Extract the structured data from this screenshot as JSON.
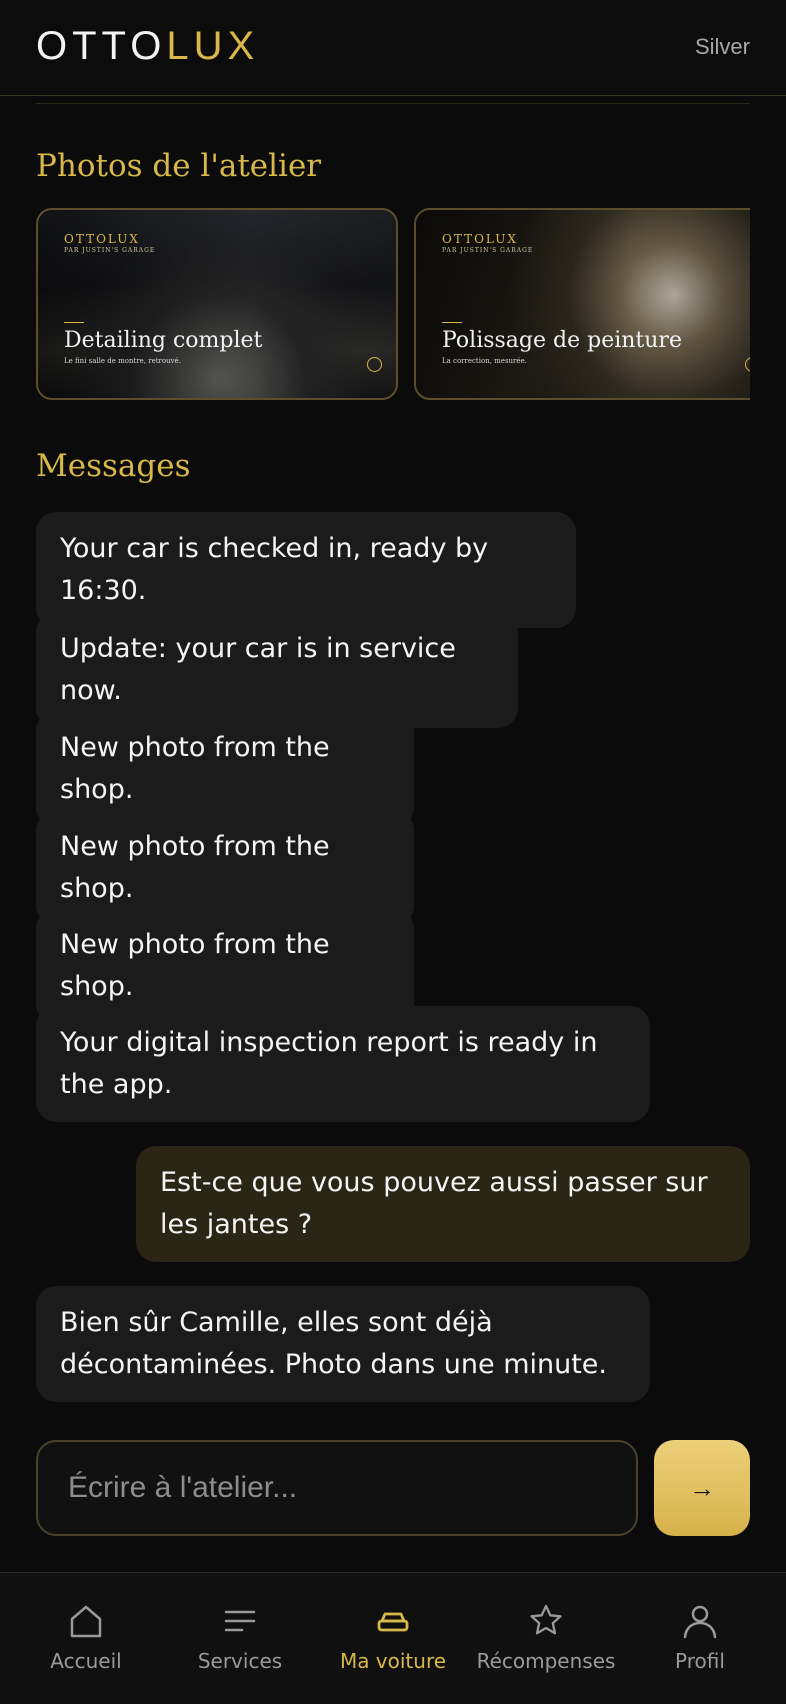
{
  "header": {
    "logo_part1": "OTTO",
    "logo_part2": "LUX",
    "tier": "Silver"
  },
  "photos_section": {
    "title": "Photos de l'atelier",
    "cards": [
      {
        "brand": "OTTOLUX",
        "sub_brand": "PAR JUSTIN'S GARAGE",
        "title": "Detailing complet",
        "caption": "Le fini salle de montre, retrouvé."
      },
      {
        "brand": "OTTOLUX",
        "sub_brand": "PAR JUSTIN'S GARAGE",
        "title": "Polissage de peinture",
        "caption": "La correction, mesurée."
      }
    ]
  },
  "messages_section": {
    "title": "Messages",
    "messages": [
      {
        "direction": "in",
        "text": "Your car is checked in, ready by 16:30."
      },
      {
        "direction": "in",
        "text": "Update: your car is in service now."
      },
      {
        "direction": "in",
        "text": "New photo from the shop."
      },
      {
        "direction": "in",
        "text": "New photo from the shop."
      },
      {
        "direction": "in",
        "text": "New photo from the shop."
      },
      {
        "direction": "in",
        "text": "Your digital inspection report is ready in the app."
      },
      {
        "direction": "out",
        "text": "Est-ce que vous pouvez aussi passer sur les jantes ?"
      },
      {
        "direction": "in",
        "text": "Bien sûr Camille, elles sont déjà décontaminées. Photo dans une minute."
      }
    ]
  },
  "composer": {
    "placeholder": "Écrire à l'atelier...",
    "value": "",
    "send_icon": "arrow-right-icon",
    "send_glyph": "→"
  },
  "nav": {
    "items": [
      {
        "label": "Accueil",
        "icon": "home-icon",
        "active": false
      },
      {
        "label": "Services",
        "icon": "list-icon",
        "active": false
      },
      {
        "label": "Ma voiture",
        "icon": "car-icon",
        "active": true
      },
      {
        "label": "Récompenses",
        "icon": "star-icon",
        "active": false
      },
      {
        "label": "Profil",
        "icon": "user-icon",
        "active": false
      }
    ]
  },
  "colors": {
    "accent": "#d9b84a",
    "background": "#0b0b0b",
    "bubble_in": "#1b1b1b",
    "bubble_out": "#2b2515"
  }
}
